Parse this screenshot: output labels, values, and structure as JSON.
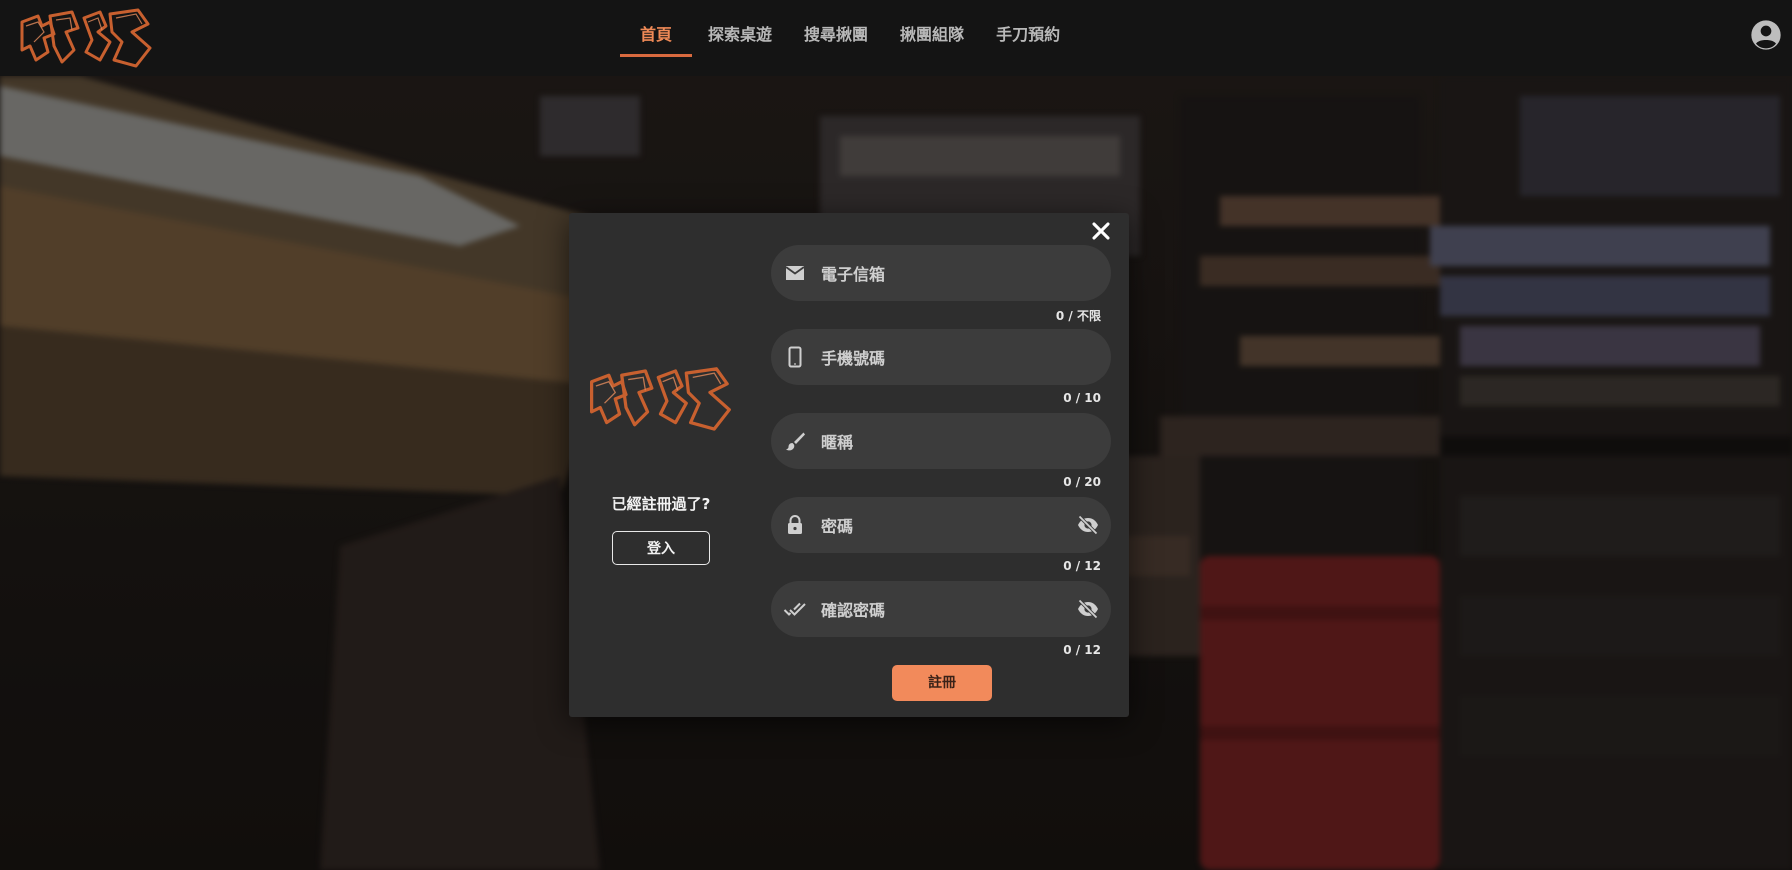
{
  "nav": {
    "items": [
      {
        "label": "首頁",
        "active": true
      },
      {
        "label": "探索桌遊",
        "active": false
      },
      {
        "label": "搜尋揪團",
        "active": false
      },
      {
        "label": "揪團組隊",
        "active": false
      },
      {
        "label": "手刀預約",
        "active": false
      }
    ]
  },
  "logo": {
    "text": "揪遊",
    "color": "#c8602f"
  },
  "avatar": {
    "icon": "account-circle-icon"
  },
  "modal": {
    "close_icon": "close-icon",
    "already_registered": "已經註冊過了?",
    "login_label": "登入",
    "fields": [
      {
        "icon": "email-icon",
        "placeholder": "電子信箱",
        "counter": "0 / 不限",
        "has_visibility_toggle": false
      },
      {
        "icon": "phone-icon",
        "placeholder": "手機號碼",
        "counter": "0 / 10",
        "has_visibility_toggle": false
      },
      {
        "icon": "brush-icon",
        "placeholder": "暱稱",
        "counter": "0 / 20",
        "has_visibility_toggle": false
      },
      {
        "icon": "lock-icon",
        "placeholder": "密碼",
        "counter": "0 / 12",
        "has_visibility_toggle": true,
        "visibility_icon": "eye-off-icon"
      },
      {
        "icon": "done-all-icon",
        "placeholder": "確認密碼",
        "counter": "0 / 12",
        "has_visibility_toggle": true,
        "visibility_icon": "eye-off-icon"
      }
    ],
    "submit_label": "註冊"
  },
  "colors": {
    "accent": "#f28a5b",
    "nav_active": "#f08a57",
    "modal_bg": "#2e2e2e",
    "field_bg": "#3c3c3c"
  }
}
